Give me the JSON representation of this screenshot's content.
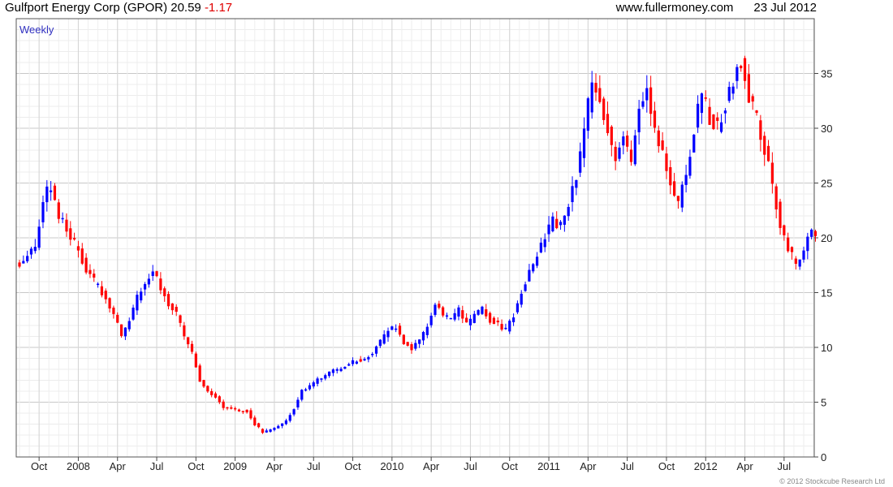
{
  "header": {
    "ticker_label": "Gulfport Energy Corp (GPOR) 20.59",
    "change": "-1.17",
    "site": "www.fullermoney.com",
    "date": "23 Jul 2012"
  },
  "footer": {
    "copyright": "© 2012 Stockcube Research Ltd"
  },
  "chart_data": {
    "type": "candlestick",
    "title": "Gulfport Energy Corp (GPOR) 20.59 -1.17",
    "frequency_label": "Weekly",
    "colors": {
      "up": "#0000ff",
      "down": "#ff0000",
      "grid": "#d8d8d8"
    },
    "ylim": [
      0,
      40
    ],
    "y_ticks": [
      0,
      5,
      10,
      15,
      20,
      25,
      30,
      35
    ],
    "y_axis_position": "right",
    "grid": true,
    "x_ticks": [
      {
        "label": "Oct",
        "week": 5
      },
      {
        "label": "2008",
        "week": 15
      },
      {
        "label": "Apr",
        "week": 25
      },
      {
        "label": "Jul",
        "week": 35
      },
      {
        "label": "Oct",
        "week": 45
      },
      {
        "label": "2009",
        "week": 55
      },
      {
        "label": "Apr",
        "week": 65
      },
      {
        "label": "Jul",
        "week": 75
      },
      {
        "label": "Oct",
        "week": 85
      },
      {
        "label": "2010",
        "week": 95
      },
      {
        "label": "Apr",
        "week": 105
      },
      {
        "label": "Jul",
        "week": 115
      },
      {
        "label": "Oct",
        "week": 125
      },
      {
        "label": "2011",
        "week": 135
      },
      {
        "label": "Apr",
        "week": 145
      },
      {
        "label": "Jul",
        "week": 155
      },
      {
        "label": "Oct",
        "week": 165
      },
      {
        "label": "2012",
        "week": 175
      },
      {
        "label": "Apr",
        "week": 185
      },
      {
        "label": "Jul",
        "week": 195
      }
    ],
    "close_anchors": [
      [
        0,
        17.8
      ],
      [
        4,
        19.2
      ],
      [
        6,
        23.5
      ],
      [
        8,
        24.8
      ],
      [
        10,
        22.0
      ],
      [
        12,
        21.0
      ],
      [
        14,
        19.5
      ],
      [
        16,
        18.0
      ],
      [
        18,
        16.5
      ],
      [
        20,
        15.5
      ],
      [
        22,
        14.5
      ],
      [
        24,
        13.0
      ],
      [
        26,
        11.0
      ],
      [
        28,
        12.5
      ],
      [
        30,
        14.5
      ],
      [
        32,
        16.0
      ],
      [
        34,
        17.0
      ],
      [
        36,
        15.5
      ],
      [
        38,
        14.0
      ],
      [
        40,
        13.0
      ],
      [
        42,
        11.0
      ],
      [
        44,
        9.5
      ],
      [
        46,
        7.0
      ],
      [
        48,
        6.0
      ],
      [
        50,
        5.5
      ],
      [
        52,
        4.5
      ],
      [
        54,
        4.5
      ],
      [
        56,
        4.3
      ],
      [
        58,
        4.2
      ],
      [
        60,
        3.0
      ],
      [
        62,
        2.2
      ],
      [
        64,
        2.5
      ],
      [
        66,
        2.8
      ],
      [
        68,
        3.2
      ],
      [
        70,
        4.5
      ],
      [
        72,
        6.0
      ],
      [
        74,
        6.5
      ],
      [
        76,
        7.0
      ],
      [
        78,
        7.5
      ],
      [
        80,
        7.8
      ],
      [
        82,
        8.0
      ],
      [
        84,
        8.5
      ],
      [
        86,
        8.8
      ],
      [
        88,
        9.0
      ],
      [
        90,
        9.5
      ],
      [
        92,
        10.5
      ],
      [
        94,
        11.5
      ],
      [
        96,
        11.8
      ],
      [
        98,
        10.5
      ],
      [
        100,
        9.8
      ],
      [
        102,
        10.5
      ],
      [
        104,
        12.0
      ],
      [
        106,
        14.0
      ],
      [
        108,
        13.0
      ],
      [
        110,
        12.5
      ],
      [
        112,
        13.5
      ],
      [
        114,
        12.0
      ],
      [
        116,
        12.8
      ],
      [
        118,
        13.5
      ],
      [
        120,
        12.5
      ],
      [
        122,
        12.0
      ],
      [
        124,
        11.5
      ],
      [
        126,
        13.0
      ],
      [
        128,
        15.0
      ],
      [
        130,
        17.0
      ],
      [
        132,
        18.5
      ],
      [
        134,
        20.0
      ],
      [
        136,
        21.5
      ],
      [
        138,
        21.0
      ],
      [
        140,
        23.0
      ],
      [
        142,
        25.5
      ],
      [
        144,
        30.0
      ],
      [
        146,
        34.0
      ],
      [
        148,
        33.0
      ],
      [
        150,
        30.0
      ],
      [
        152,
        27.0
      ],
      [
        154,
        29.0
      ],
      [
        156,
        27.0
      ],
      [
        158,
        32.0
      ],
      [
        160,
        34.0
      ],
      [
        162,
        30.0
      ],
      [
        164,
        28.0
      ],
      [
        166,
        25.0
      ],
      [
        168,
        23.0
      ],
      [
        170,
        26.0
      ],
      [
        172,
        30.0
      ],
      [
        174,
        33.0
      ],
      [
        176,
        31.0
      ],
      [
        178,
        30.0
      ],
      [
        180,
        32.0
      ],
      [
        182,
        34.5
      ],
      [
        184,
        36.0
      ],
      [
        186,
        33.0
      ],
      [
        188,
        31.0
      ],
      [
        190,
        28.0
      ],
      [
        192,
        25.0
      ],
      [
        194,
        21.0
      ],
      [
        196,
        19.0
      ],
      [
        198,
        17.5
      ],
      [
        200,
        19.0
      ],
      [
        202,
        20.5
      ],
      [
        203,
        20.59
      ]
    ]
  }
}
